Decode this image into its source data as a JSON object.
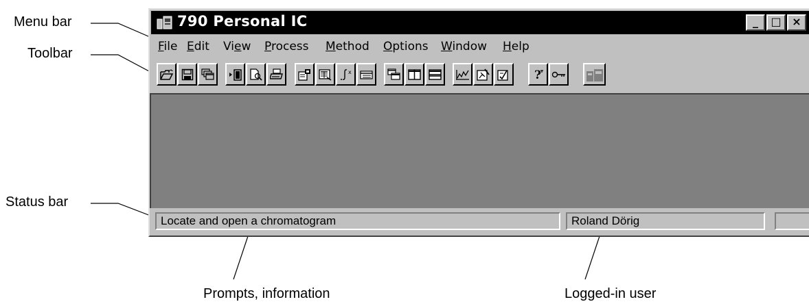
{
  "window": {
    "title": "790 Personal IC",
    "controls": {
      "minimize": "_",
      "maximize": "□",
      "close": "×"
    }
  },
  "menu": [
    {
      "mnemonic": "F",
      "rest": "ile"
    },
    {
      "mnemonic": "E",
      "rest": "dit"
    },
    {
      "pre": "Vi",
      "mnemonic": "e",
      "rest": "w"
    },
    {
      "mnemonic": "P",
      "rest": "rocess"
    },
    {
      "mnemonic": "M",
      "rest": "ethod"
    },
    {
      "mnemonic": "O",
      "rest": "ptions"
    },
    {
      "mnemonic": "W",
      "rest": "indow"
    },
    {
      "mnemonic": "H",
      "rest": "elp"
    }
  ],
  "toolbar": {
    "buttons": [
      {
        "icon": "open-folder-icon"
      },
      {
        "icon": "save-disk-icon"
      },
      {
        "icon": "copy-windows-icon"
      },
      {
        "icon": "send-to-device-icon"
      },
      {
        "icon": "print-preview-icon"
      },
      {
        "icon": "print-icon"
      },
      {
        "icon": "properties-icon"
      },
      {
        "icon": "report-icon"
      },
      {
        "icon": "integration-icon"
      },
      {
        "icon": "table-icon"
      },
      {
        "icon": "cascade-windows-icon"
      },
      {
        "icon": "tile-vertical-icon"
      },
      {
        "icon": "tile-horizontal-icon"
      },
      {
        "icon": "chromatogram-edit-icon"
      },
      {
        "icon": "calibration-edit-icon"
      },
      {
        "icon": "method-edit-icon"
      },
      {
        "icon": "help-icon"
      },
      {
        "icon": "key-icon"
      },
      {
        "icon": "device-icon",
        "disabled": true
      }
    ]
  },
  "status": {
    "prompt": "Locate and open a chromatogram",
    "user": "Roland Dörig",
    "extra": ""
  },
  "annotations": {
    "menu_bar": "Menu bar",
    "toolbar": "Toolbar",
    "status_bar": "Status bar",
    "prompts": "Prompts, information",
    "user": "Logged-in user"
  },
  "colors": {
    "face": "#c0c0c0",
    "titlebar": "#000000",
    "workspace": "#808080"
  }
}
